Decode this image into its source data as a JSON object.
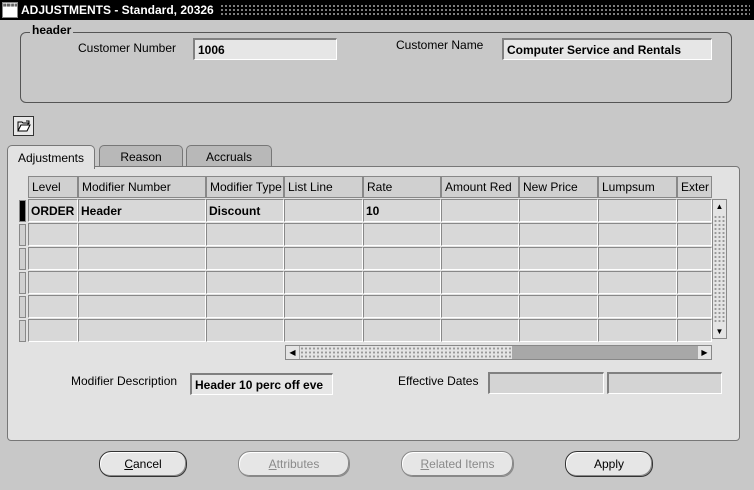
{
  "window": {
    "title": "ADJUSTMENTS - Standard, 20326",
    "icon": "oracle-forms-icon"
  },
  "header": {
    "group_label": "header",
    "customer_number_label": "Customer Number",
    "customer_number_value": "1006",
    "customer_name_label": "Customer Name",
    "customer_name_value": "Computer Service and Rentals"
  },
  "toolbar": {
    "folder_icon": "folder-open-icon"
  },
  "tabs": [
    {
      "label": "Adjustments",
      "active": true
    },
    {
      "label": "Reason",
      "active": false
    },
    {
      "label": "Accruals",
      "active": false
    }
  ],
  "grid": {
    "columns": [
      "Level",
      "Modifier Number",
      "Modifier Type",
      "List Line",
      "Rate",
      "Amount Red",
      "New Price",
      "Lumpsum",
      "Exter"
    ],
    "rows": [
      [
        "ORDER",
        "Header",
        "Discount",
        "",
        "10",
        "",
        "",
        "",
        ""
      ],
      [
        "",
        "",
        "",
        "",
        "",
        "",
        "",
        "",
        ""
      ],
      [
        "",
        "",
        "",
        "",
        "",
        "",
        "",
        "",
        ""
      ],
      [
        "",
        "",
        "",
        "",
        "",
        "",
        "",
        "",
        ""
      ],
      [
        "",
        "",
        "",
        "",
        "",
        "",
        "",
        "",
        ""
      ],
      [
        "",
        "",
        "",
        "",
        "",
        "",
        "",
        "",
        ""
      ]
    ]
  },
  "details": {
    "modifier_description_label": "Modifier Description",
    "modifier_description_value": "Header 10 perc off eve",
    "effective_dates_label": "Effective Dates",
    "effective_date_from": "",
    "effective_date_to": ""
  },
  "buttons": {
    "cancel": "Cancel",
    "attributes": "Attributes",
    "related_items": "Related Items",
    "apply": "Apply"
  }
}
